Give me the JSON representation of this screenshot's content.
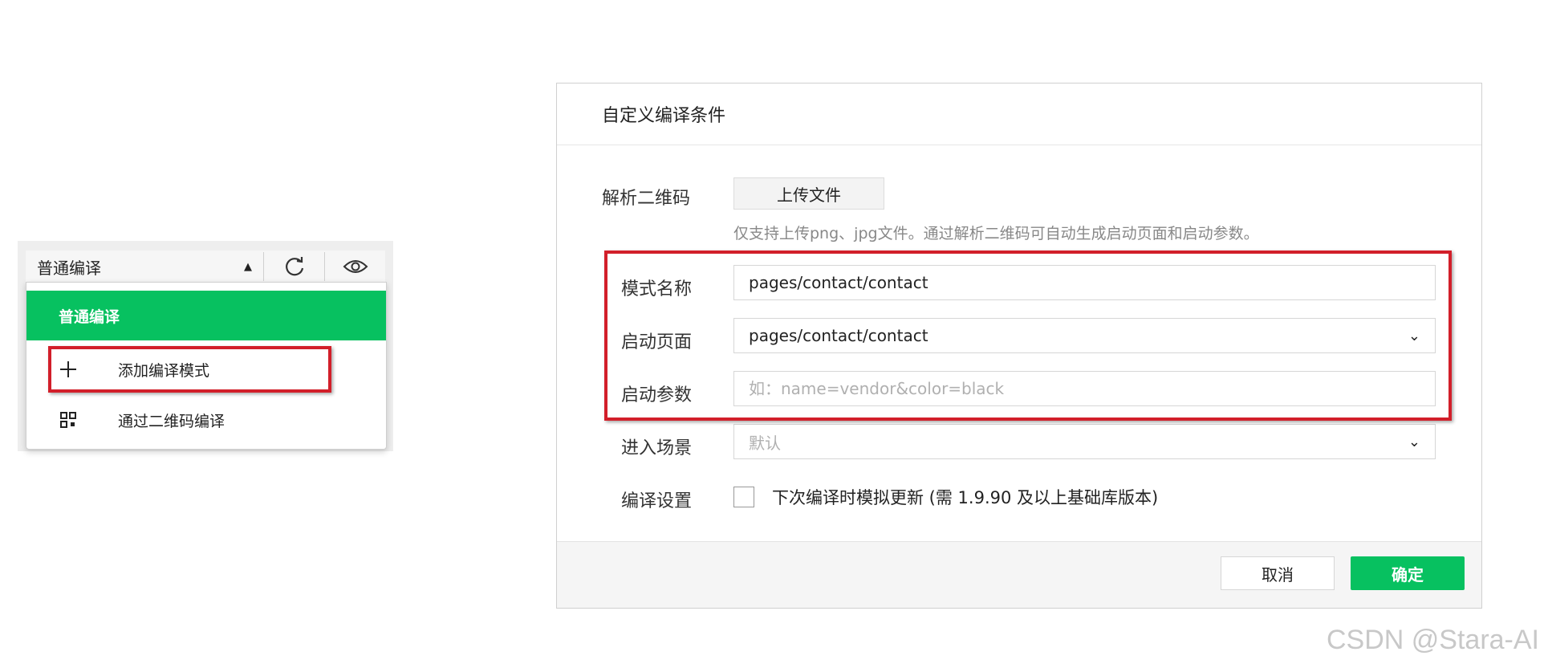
{
  "compile_menu": {
    "current_mode": "普通编译",
    "active_item": "普通编译",
    "add_mode_label": "添加编译模式",
    "qr_compile_label": "通过二维码编译"
  },
  "dialog": {
    "title": "自定义编译条件",
    "qr_label": "解析二维码",
    "upload_button": "上传文件",
    "upload_hint": "仅支持上传png、jpg文件。通过解析二维码可自动生成启动页面和启动参数。",
    "mode_name_label": "模式名称",
    "mode_name_value": "pages/contact/contact",
    "start_page_label": "启动页面",
    "start_page_value": "pages/contact/contact",
    "start_params_label": "启动参数",
    "start_params_placeholder": "如：name=vendor&color=black",
    "scene_label": "进入场景",
    "scene_value": "默认",
    "compile_settings_label": "编译设置",
    "simulate_update_label": "下次编译时模拟更新 (需 1.9.90 及以上基础库版本)",
    "cancel_button": "取消",
    "confirm_button": "确定"
  },
  "watermark": "CSDN @Stara-AI",
  "colors": {
    "accent": "#07c160",
    "highlight": "#d21f2a"
  }
}
